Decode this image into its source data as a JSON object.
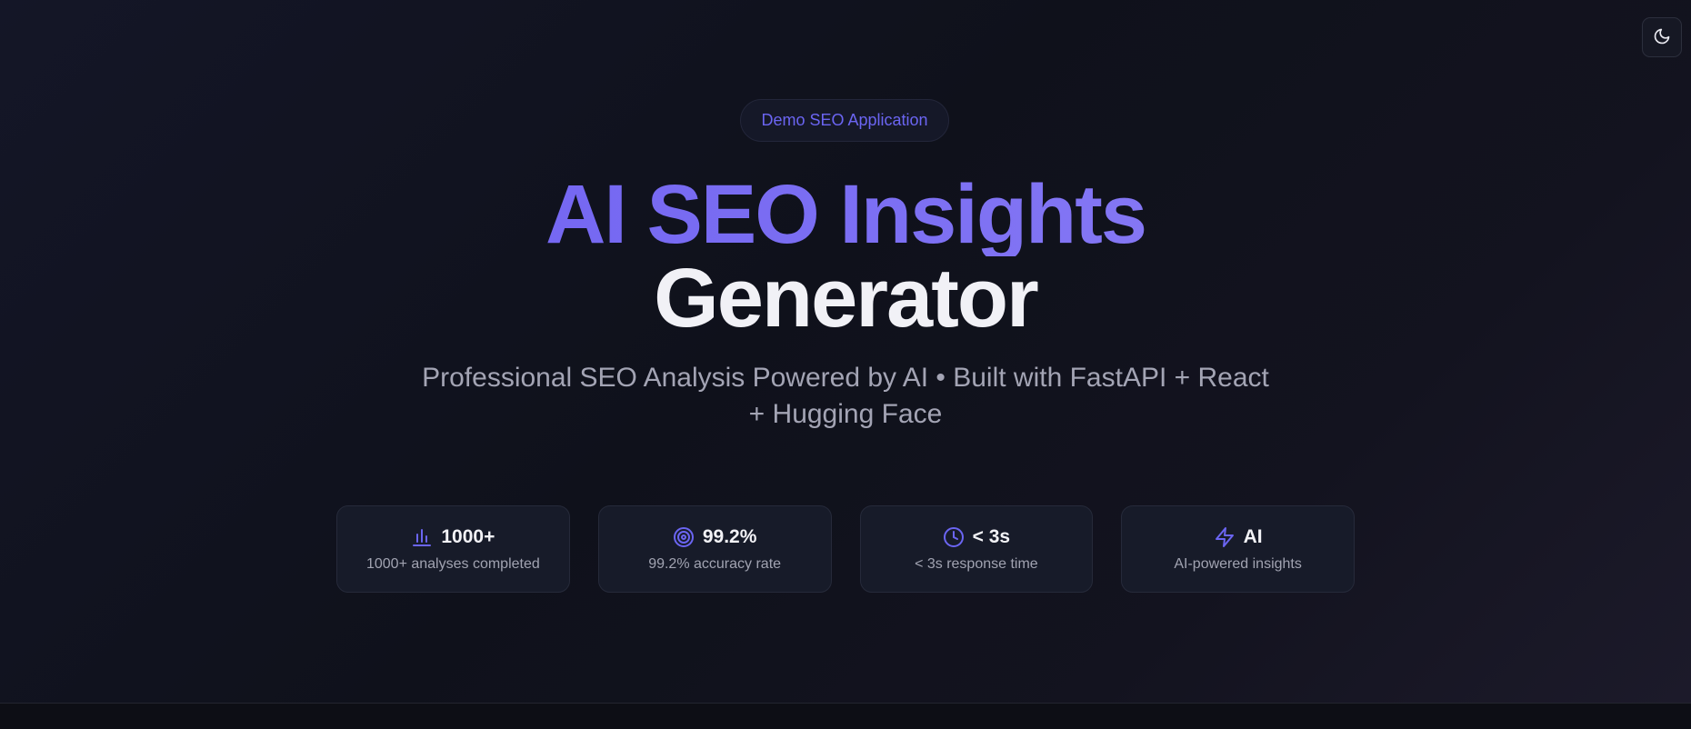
{
  "header": {
    "theme_toggle_icon": "moon-icon"
  },
  "hero": {
    "badge": "Demo SEO Application",
    "title_line1": "AI SEO Insights",
    "title_line2": "Generator",
    "subtitle": "Professional SEO Analysis Powered by AI • Built with FastAPI + React + Hugging Face",
    "accent_color": "#6b65f2"
  },
  "stats": [
    {
      "icon": "bar-chart-icon",
      "value": "1000+",
      "label": "1000+ analyses completed"
    },
    {
      "icon": "target-icon",
      "value": "99.2%",
      "label": "99.2% accuracy rate"
    },
    {
      "icon": "clock-icon",
      "value": "< 3s",
      "label": "< 3s response time"
    },
    {
      "icon": "lightning-icon",
      "value": "AI",
      "label": "AI-powered insights"
    }
  ]
}
